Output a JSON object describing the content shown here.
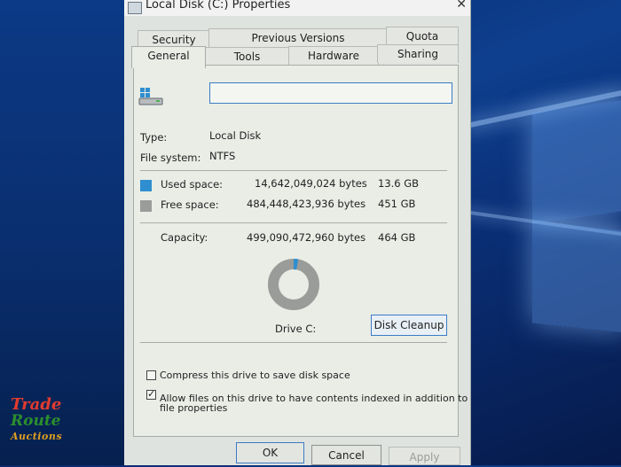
{
  "window": {
    "title": "Local Disk (C:) Properties"
  },
  "tabs": {
    "row1": [
      {
        "label": "Security"
      },
      {
        "label": "Previous Versions"
      },
      {
        "label": "Quota"
      }
    ],
    "row2": [
      {
        "label": "General"
      },
      {
        "label": "Tools"
      },
      {
        "label": "Hardware"
      },
      {
        "label": "Sharing"
      }
    ]
  },
  "general": {
    "name_value": "",
    "type_label": "Type:",
    "type_value": "Local Disk",
    "fs_label": "File system:",
    "fs_value": "NTFS",
    "used": {
      "label": "Used space:",
      "bytes": "14,642,049,024 bytes",
      "size": "13.6 GB",
      "color": "#2f8ecf"
    },
    "free": {
      "label": "Free space:",
      "bytes": "484,448,423,936 bytes",
      "size": "451 GB",
      "color": "#9a9c99"
    },
    "capacity": {
      "label": "Capacity:",
      "bytes": "499,090,472,960 bytes",
      "size": "464 GB"
    },
    "used_fraction": 0.029,
    "drive_label": "Drive C:",
    "disk_cleanup_label": "Disk Cleanup",
    "compress_label": "Compress this drive to save disk space",
    "compress_checked": false,
    "index_label_line1": "Allow files on this drive to have contents indexed in addition to",
    "index_label_line2": "file properties",
    "index_checked": true
  },
  "buttons": {
    "ok": "OK",
    "cancel": "Cancel",
    "apply": "Apply"
  },
  "watermark": {
    "line1": "Trade",
    "line2": "Route",
    "line3": "Auctions"
  },
  "icons": {
    "window_icon": "drive-icon",
    "close_icon": "close-icon",
    "drive_icon": "hard-drive-icon"
  }
}
